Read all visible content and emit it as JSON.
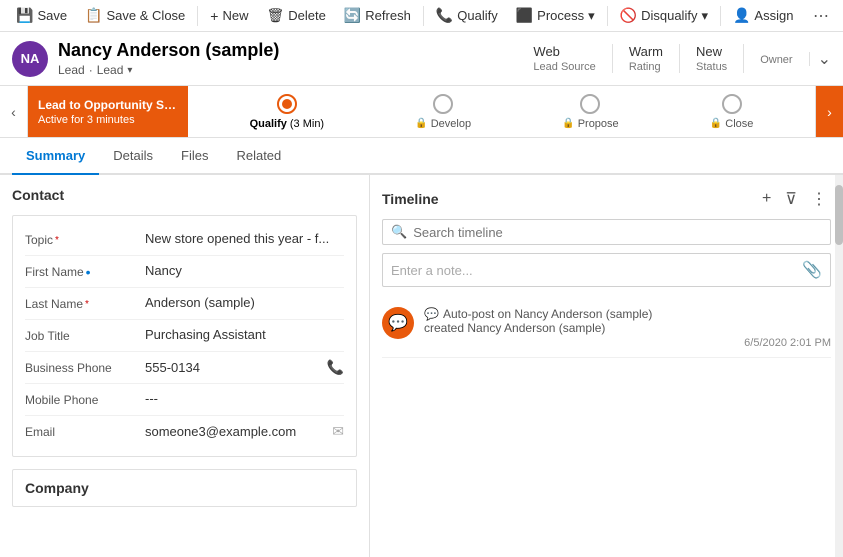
{
  "toolbar": {
    "save_label": "Save",
    "save_close_label": "Save & Close",
    "new_label": "New",
    "delete_label": "Delete",
    "refresh_label": "Refresh",
    "qualify_label": "Qualify",
    "process_label": "Process",
    "disqualify_label": "Disqualify",
    "assign_label": "Assign",
    "more_icon": "⋯"
  },
  "header": {
    "avatar_initials": "NA",
    "title": "Nancy Anderson (sample)",
    "subtitle_lead": "Lead",
    "subtitle_type": "Lead",
    "meta": [
      {
        "value": "Web",
        "label": "Lead Source"
      },
      {
        "value": "Warm",
        "label": "Rating"
      },
      {
        "value": "New",
        "label": "Status"
      },
      {
        "value": "",
        "label": "Owner"
      }
    ]
  },
  "stage_bar": {
    "promo_title": "Lead to Opportunity Sale...",
    "promo_sub": "Active for 3 minutes",
    "stages": [
      {
        "label": "Qualify",
        "duration": "(3 Min)",
        "state": "active",
        "locked": false
      },
      {
        "label": "Develop",
        "duration": "",
        "state": "future",
        "locked": true
      },
      {
        "label": "Propose",
        "duration": "",
        "state": "future",
        "locked": true
      },
      {
        "label": "Close",
        "duration": "",
        "state": "future",
        "locked": true
      }
    ]
  },
  "tabs": [
    {
      "label": "Summary",
      "active": true
    },
    {
      "label": "Details",
      "active": false
    },
    {
      "label": "Files",
      "active": false
    },
    {
      "label": "Related",
      "active": false
    }
  ],
  "contact": {
    "section_title": "Contact",
    "fields": [
      {
        "label": "Topic",
        "required": true,
        "value": "New store opened this year - f...",
        "icon": "",
        "optional": false
      },
      {
        "label": "First Name",
        "required": false,
        "value": "Nancy",
        "icon": "",
        "optional": true
      },
      {
        "label": "Last Name",
        "required": true,
        "value": "Anderson (sample)",
        "icon": "",
        "optional": false
      },
      {
        "label": "Job Title",
        "required": false,
        "value": "Purchasing Assistant",
        "icon": "",
        "optional": false
      },
      {
        "label": "Business Phone",
        "required": false,
        "value": "555-0134",
        "icon": "📞",
        "optional": false
      },
      {
        "label": "Mobile Phone",
        "required": false,
        "value": "---",
        "icon": "",
        "optional": false
      },
      {
        "label": "Email",
        "required": false,
        "value": "someone3@example.com",
        "icon": "✉",
        "optional": false
      }
    ]
  },
  "company": {
    "section_title": "Company"
  },
  "timeline": {
    "title": "Timeline",
    "search_placeholder": "Search timeline",
    "note_placeholder": "Enter a note...",
    "entries": [
      {
        "type_icon": "💬",
        "type_label": "Auto-post on Nancy Anderson (sample)",
        "subtitle": "created Nancy Anderson (sample)",
        "date": "6/5/2020 2:01 PM"
      }
    ]
  }
}
